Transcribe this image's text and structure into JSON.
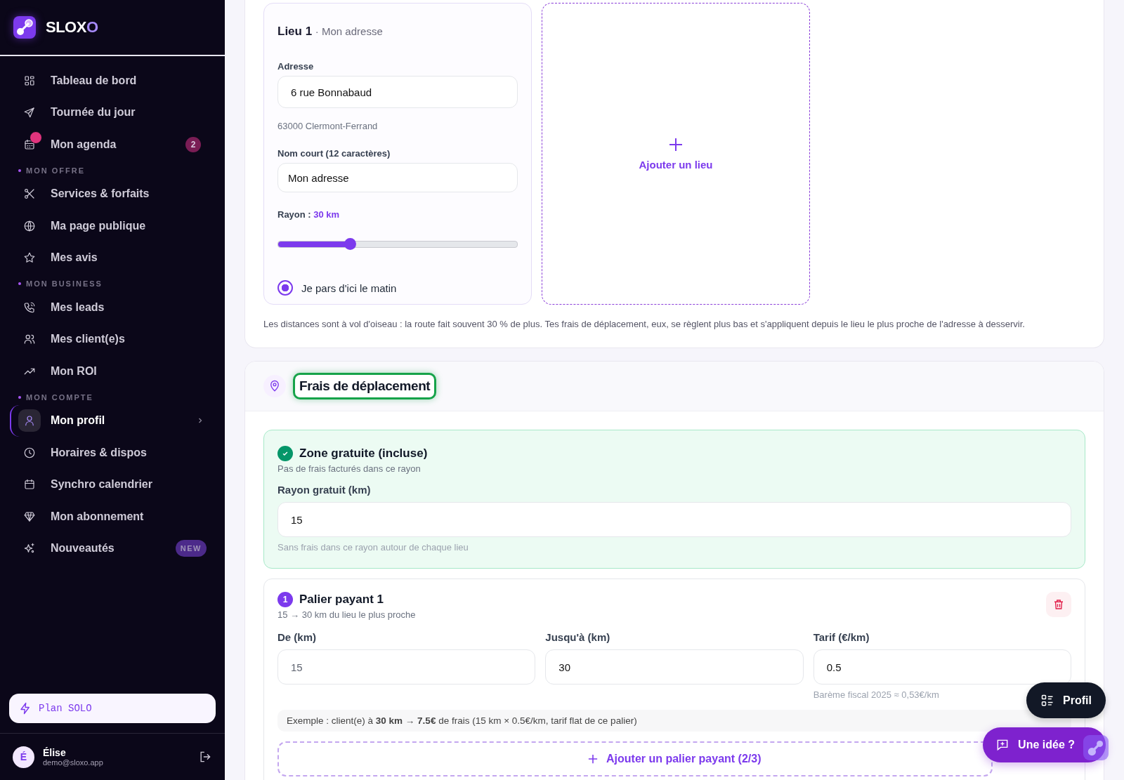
{
  "brand": {
    "name_main": "SLOX",
    "name_accent": "O"
  },
  "nav": [
    {
      "kind": "item",
      "label": "Tableau de bord",
      "selected": false,
      "alert": false
    },
    {
      "kind": "item",
      "label": "Tournée du jour",
      "selected": false,
      "alert": false
    },
    {
      "kind": "item",
      "label": "Mon agenda",
      "selected": false,
      "alert": true,
      "badge": {
        "kind": "count",
        "text": "2"
      }
    },
    {
      "kind": "section",
      "label": "MON OFFRE"
    },
    {
      "kind": "item",
      "label": "Services & forfaits",
      "selected": false,
      "alert": false
    },
    {
      "kind": "item",
      "label": "Ma page publique",
      "selected": false,
      "alert": false
    },
    {
      "kind": "item",
      "label": "Mes avis",
      "selected": false,
      "alert": false
    },
    {
      "kind": "section",
      "label": "MON BUSINESS"
    },
    {
      "kind": "item",
      "label": "Mes leads",
      "selected": false,
      "alert": false
    },
    {
      "kind": "item",
      "label": "Mes client(e)s",
      "selected": false,
      "alert": false
    },
    {
      "kind": "item",
      "label": "Mon ROI",
      "selected": false,
      "alert": false
    },
    {
      "kind": "section",
      "label": "MON COMPTE"
    },
    {
      "kind": "item",
      "label": "Mon profil",
      "selected": true,
      "alert": false
    },
    {
      "kind": "item",
      "label": "Horaires & dispos",
      "selected": false,
      "alert": false
    },
    {
      "kind": "item",
      "label": "Synchro calendrier",
      "selected": false,
      "alert": false
    },
    {
      "kind": "item",
      "label": "Mon abonnement",
      "selected": false,
      "alert": false
    },
    {
      "kind": "item",
      "label": "Nouveautés",
      "selected": false,
      "alert": false,
      "badge": {
        "kind": "new",
        "text": "NEW"
      }
    }
  ],
  "plan": {
    "label": "Plan SOLO"
  },
  "user": {
    "initial": "É",
    "name": "Élise",
    "email": "demo@sloxo.app"
  },
  "location": {
    "title": "Lieu 1",
    "subtitle": "· Mon adresse",
    "address_label": "Adresse",
    "address": "6 rue Bonnabaud",
    "city": "63000 Clermont-Ferrand",
    "short_name_label": "Nom court (12 caractères)",
    "short_name": "Mon adresse",
    "radius_label": "Rayon :",
    "radius_value": "30 km",
    "level": 0.3,
    "start_here": {
      "label": "Je pars d'ici le matin",
      "selected": true
    }
  },
  "add_location": {
    "label": "Ajouter un lieu"
  },
  "distance_note": "Les distances sont à vol d'oiseau : la route fait souvent 30 % de plus. Tes frais de déplacement, eux, se règlent plus bas et s'appliquent depuis le lieu le plus proche de l'adresse à desservir.",
  "travel": {
    "title": "Frais de déplacement",
    "highlighted": true,
    "free_zone": {
      "title": "Zone gratuite (incluse)",
      "subtitle": "Pas de frais facturés dans ce rayon",
      "field_label": "Rayon gratuit (km)",
      "value": "15",
      "hint": "Sans frais dans ce rayon autour de chaque lieu"
    },
    "tier": {
      "number": "1",
      "title": "Palier payant 1",
      "subtitle": "15 → 30 km du lieu le plus proche",
      "fields": [
        {
          "label": "De (km)",
          "value": "15",
          "disabled": true
        },
        {
          "label": "Jusqu'à (km)",
          "value": "30",
          "disabled": false
        },
        {
          "label": "Tarif (€/km)",
          "value": "0.5",
          "disabled": false,
          "hint": "Barème fiscal 2025 ≈ 0,53€/km"
        }
      ],
      "example": "Exemple : client(e) à **30 km** → **7.5€** de frais (15 km × 0.5€/km, tarif flat de ce palier)"
    },
    "add_tier": {
      "label": "Ajouter un palier payant (2/3)"
    }
  },
  "fabs": {
    "profile": "Profil",
    "idea": "Une idée ?"
  }
}
